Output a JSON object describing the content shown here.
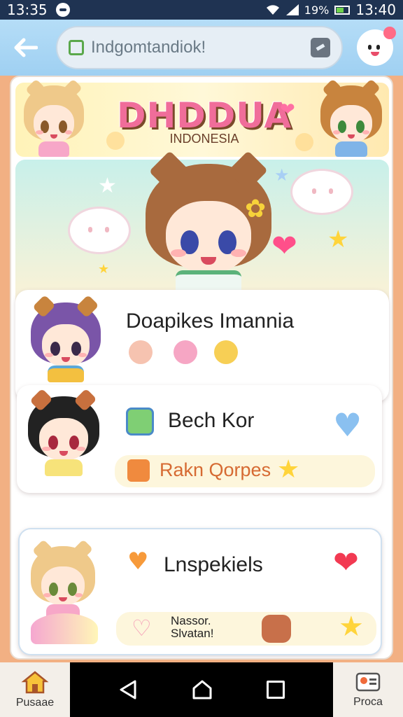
{
  "status_bar": {
    "time_left": "13:35",
    "battery_percent": "19%",
    "time_right": "13:40"
  },
  "app_bar": {
    "back_icon": "arrow-left-icon",
    "url_text": "Indgomtandiok!",
    "lock_icon": "lock-icon",
    "action_icon": "edit-icon",
    "mascot_icon": "mascot-avatar-icon"
  },
  "banner": {
    "title": "DHDDUA",
    "subtitle": "INDONESIA"
  },
  "cards": [
    {
      "title": "Doapikes Imannia"
    },
    {
      "title": "Bech Kor",
      "pill_label": "Rakn Qorpes"
    },
    {
      "title": "Lnspekiels",
      "small_label_1": "Nassor.",
      "small_label_2": "Slvatan!"
    }
  ],
  "bottom_nav": {
    "home_label": "Pusaae",
    "profile_label": "Proca"
  },
  "colors": {
    "status_bar_bg": "#1f3352",
    "app_bar_bg": "#9fd0f2",
    "accent_pink": "#f06d9a",
    "pill_text": "#d66a32"
  }
}
